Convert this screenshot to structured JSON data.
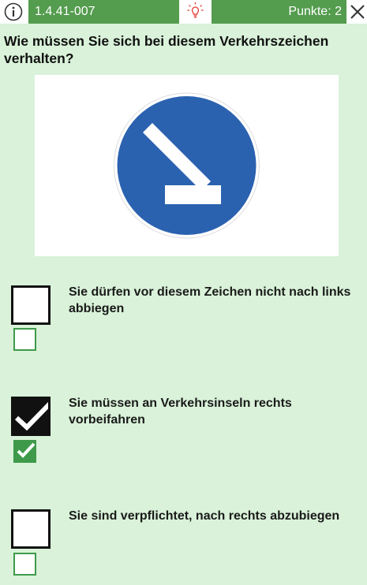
{
  "header": {
    "question_id": "1.4.41-007",
    "points": "Punkte: 2",
    "icons": {
      "info": "info-icon",
      "hint": "lightbulb-icon",
      "close": "close-icon"
    },
    "colors": {
      "bar": "#549c4e"
    }
  },
  "question": {
    "text": "Wie müssen Sie sich bei diesem Verkehrszeichen verhalten?",
    "image": "blue-round-sign-arrow-down-right",
    "sign_color": "#2b62b0"
  },
  "answers": [
    {
      "text": "Sie dürfen vor diesem Zeichen nicht nach links abbiegen",
      "selected": false,
      "correct": false
    },
    {
      "text": "Sie müssen an Verkehrsinseln rechts vorbeifahren",
      "selected": true,
      "correct": true
    },
    {
      "text": "Sie sind verpflichtet, nach rechts abzubiegen",
      "selected": false,
      "correct": false
    }
  ],
  "colors": {
    "background": "#d9f2d9",
    "check_green": "#3e9a4a"
  }
}
